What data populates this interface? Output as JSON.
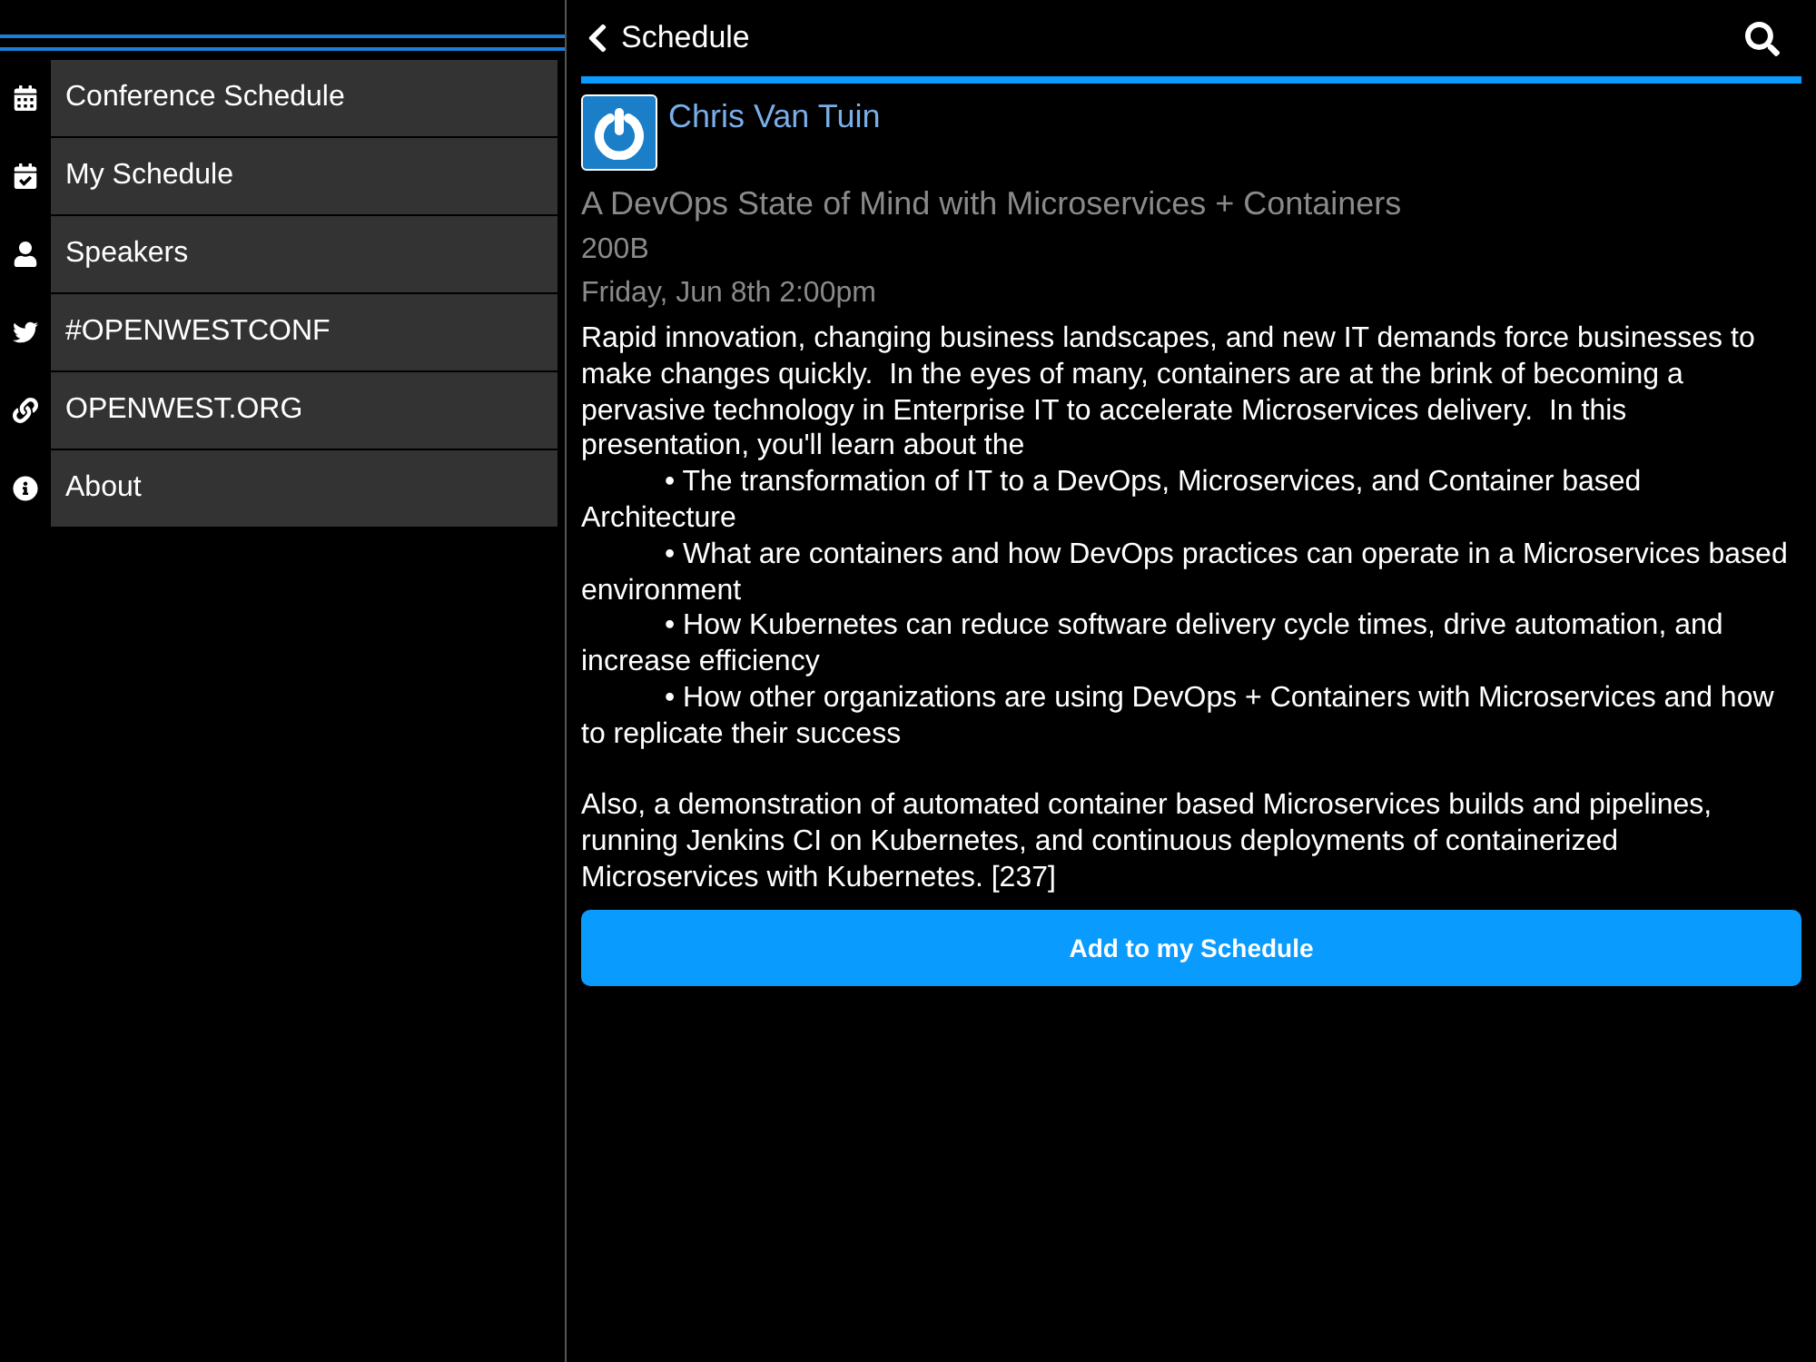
{
  "sidebar": {
    "items": [
      {
        "label": "Conference Schedule",
        "kind": "calendar"
      },
      {
        "label": "My Schedule",
        "kind": "calendar-check"
      },
      {
        "label": "Speakers",
        "kind": "person"
      },
      {
        "label": "#OPENWESTCONF",
        "kind": "bird"
      },
      {
        "label": "OPENWEST.ORG",
        "kind": "link"
      },
      {
        "label": "About",
        "kind": "info"
      }
    ]
  },
  "header": {
    "back_label": "Schedule"
  },
  "session": {
    "speaker": "Chris Van Tuin",
    "title": "A DevOps State of Mind with Microservices + Containers",
    "room": "200B",
    "time": "Friday, Jun 8th 2:00pm",
    "description": [
      {
        "kind": "paragraph",
        "text": "Rapid innovation, changing business landscapes, and new IT demands force businesses to make changes quickly.  In the eyes of many, containers are at the brink of becoming a pervasive technology in Enterprise IT to accelerate Microservices delivery.  In this presentation, you'll learn about the"
      },
      {
        "kind": "bullet",
        "text": "• The transformation of IT to a DevOps, Microservices, and Container based Architecture"
      },
      {
        "kind": "bullet",
        "text": "• What are containers and how DevOps practices can operate in a Microservices based environment"
      },
      {
        "kind": "bullet",
        "text": "• How Kubernetes can reduce software delivery cycle times, drive automation, and increase efficiency"
      },
      {
        "kind": "bullet",
        "text": "• How other organizations are using DevOps + Containers with Microservices and how to replicate their success"
      },
      {
        "kind": "gap"
      },
      {
        "kind": "paragraph",
        "text": "Also, a demonstration of automated container based Microservices builds and pipelines, running Jenkins CI on Kubernetes, and continuous deployments of containerized Microservices with Kubernetes. [237]"
      }
    ],
    "button": "Add to my Schedule"
  }
}
